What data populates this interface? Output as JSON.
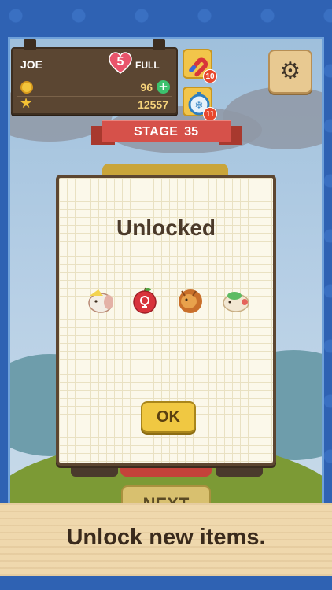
{
  "player": {
    "name": "JOE",
    "lives": "5",
    "lives_status": "FULL",
    "coins": "96",
    "stars": "12557"
  },
  "powerups": [
    {
      "icon": "magnet-icon",
      "count": "10"
    },
    {
      "icon": "stopwatch-icon",
      "count": "11"
    }
  ],
  "stage": {
    "label": "STAGE",
    "number": "35"
  },
  "dialog": {
    "title": "Unlocked",
    "items": [
      "hamster-item-icon",
      "apple-item-icon",
      "lion-item-icon",
      "turtle-item-icon"
    ],
    "ok_label": "OK"
  },
  "background": {
    "next_label": "NEXT"
  },
  "caption": {
    "text": "Unlock new items."
  },
  "colors": {
    "frame_blue": "#2f62b3",
    "wood": "#5b4632",
    "ribbon": "#d6514a",
    "button_yellow": "#f0c842"
  }
}
